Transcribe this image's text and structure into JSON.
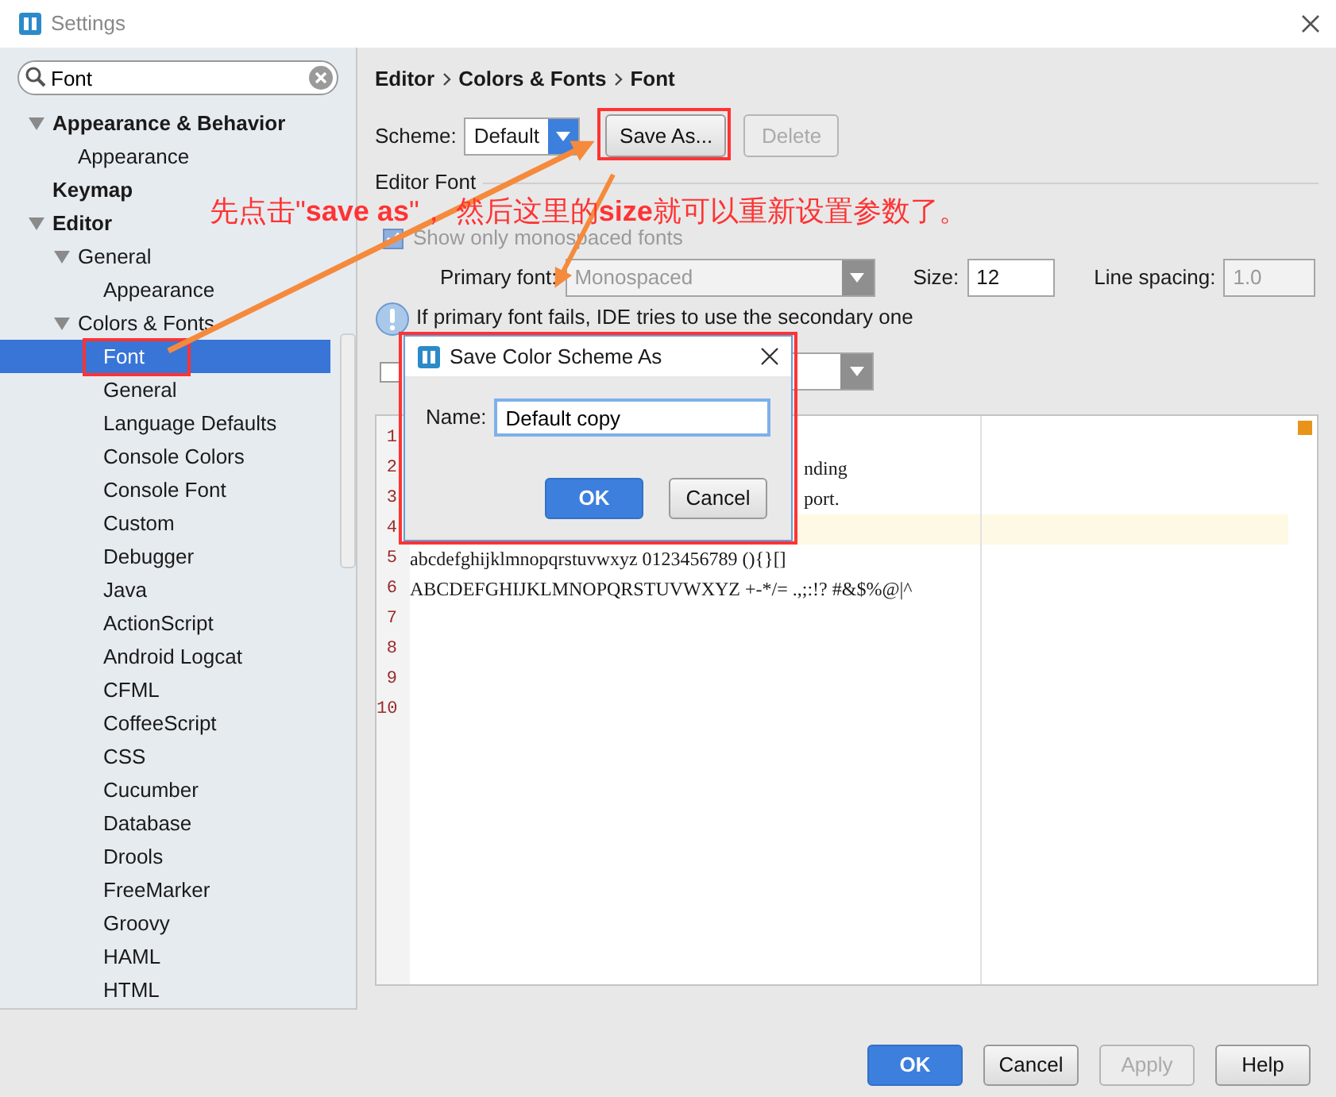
{
  "window": {
    "title": "Settings"
  },
  "search": {
    "value": "Font"
  },
  "tree": [
    {
      "label": "Appearance & Behavior",
      "expanded": true,
      "selected": false,
      "children": [
        {
          "label": "Appearance",
          "selected": false
        }
      ]
    },
    {
      "label": "Keymap",
      "selected": false
    },
    {
      "label": "Editor",
      "expanded": true,
      "selected": false,
      "children": [
        {
          "label": "General",
          "expanded": true,
          "selected": false,
          "children": [
            {
              "label": "Appearance",
              "selected": false
            }
          ]
        },
        {
          "label": "Colors & Fonts",
          "expanded": true,
          "selected": false,
          "children": [
            {
              "label": "Font",
              "selected": true
            },
            {
              "label": "General",
              "selected": false
            },
            {
              "label": "Language Defaults",
              "selected": false
            },
            {
              "label": "Console Colors",
              "selected": false
            },
            {
              "label": "Console Font",
              "selected": false
            },
            {
              "label": "Custom",
              "selected": false
            },
            {
              "label": "Debugger",
              "selected": false
            },
            {
              "label": "Java",
              "selected": false
            },
            {
              "label": "ActionScript",
              "selected": false
            },
            {
              "label": "Android Logcat",
              "selected": false
            },
            {
              "label": "CFML",
              "selected": false
            },
            {
              "label": "CoffeeScript",
              "selected": false
            },
            {
              "label": "CSS",
              "selected": false
            },
            {
              "label": "Cucumber",
              "selected": false
            },
            {
              "label": "Database",
              "selected": false
            },
            {
              "label": "Drools",
              "selected": false
            },
            {
              "label": "FreeMarker",
              "selected": false
            },
            {
              "label": "Groovy",
              "selected": false
            },
            {
              "label": "HAML",
              "selected": false
            },
            {
              "label": "HTML",
              "selected": false
            }
          ]
        }
      ]
    }
  ],
  "breadcrumb": [
    "Editor",
    "Colors & Fonts",
    "Font"
  ],
  "scheme": {
    "label": "Scheme:",
    "value": "Default"
  },
  "scheme_buttons": [
    {
      "label": "Save As...",
      "disabled": false
    },
    {
      "label": "Delete",
      "disabled": true
    }
  ],
  "editor_font": {
    "section_title": "Editor Font",
    "monospaced_only": {
      "label": "Show only monospaced fonts",
      "checked": true,
      "disabled": true
    },
    "primary_font": {
      "label": "Primary font:",
      "value": "Monospaced",
      "disabled": true
    },
    "size": {
      "label": "Size:",
      "value": "12",
      "disabled": false
    },
    "line_spacing": {
      "label": "Line spacing:",
      "value": "1.0",
      "disabled": true
    },
    "hint": "If primary font fails, IDE tries to use the secondary one",
    "secondary_font": {
      "checked": false
    }
  },
  "preview": {
    "lines": [
      {
        "number": "1",
        "current": false
      },
      {
        "number": "2",
        "kind": "partial",
        "text": "nding",
        "current": false
      },
      {
        "number": "3",
        "kind": "partial",
        "text": "port.",
        "current": false
      },
      {
        "number": "4",
        "current": true
      },
      {
        "number": "5",
        "kind": "full",
        "text": "abcdefghijklmnopqrstuvwxyz 0123456789 (){}[]",
        "current": false
      },
      {
        "number": "6",
        "kind": "full",
        "text": "ABCDEFGHIJKLMNOPQRSTUVWXYZ +-*/= .,;:!? #&$%@|^",
        "current": false
      },
      {
        "number": "7",
        "current": false
      },
      {
        "number": "8",
        "current": false
      },
      {
        "number": "9",
        "current": false
      },
      {
        "number": "10",
        "current": false
      }
    ]
  },
  "dialog": {
    "title": "Save Color Scheme As",
    "name_label": "Name:",
    "name_value": "Default copy",
    "buttons": [
      {
        "label": "OK",
        "kind": "primary"
      },
      {
        "label": "Cancel",
        "kind": "secondary"
      }
    ]
  },
  "footer_buttons": [
    {
      "label": "OK",
      "kind": "primary",
      "disabled": false
    },
    {
      "label": "Cancel",
      "kind": "secondary",
      "disabled": false
    },
    {
      "label": "Apply",
      "kind": "secondary",
      "disabled": true
    },
    {
      "label": "Help",
      "kind": "secondary",
      "disabled": false
    }
  ],
  "annotation": {
    "text": "先点击\"**save as**\"， 然后这里的**size**就可以重新设置参数了。"
  }
}
